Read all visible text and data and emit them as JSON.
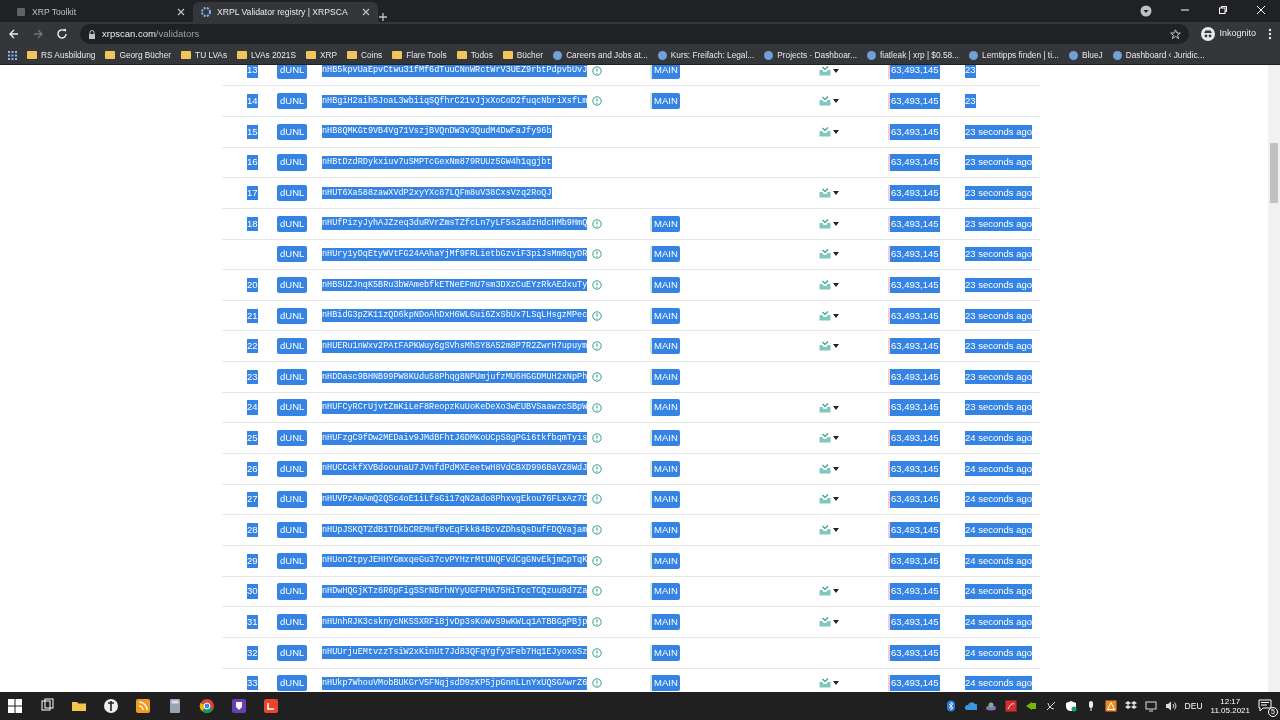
{
  "browser": {
    "tabs": [
      {
        "title": "XRP Toolkit",
        "selected": false
      },
      {
        "title": "XRPL Validator registry | XRPSCA",
        "selected": true
      }
    ],
    "url_host": "xrpscan.com",
    "url_path": "/validators",
    "profile": "Inkognito",
    "bookmarks": [
      {
        "label": "RS Ausbildung",
        "kind": "folder"
      },
      {
        "label": "Georg Bücher",
        "kind": "folder"
      },
      {
        "label": "TU LVAs",
        "kind": "folder"
      },
      {
        "label": "LVAs 2021S",
        "kind": "folder"
      },
      {
        "label": "XRP",
        "kind": "folder"
      },
      {
        "label": "Coins",
        "kind": "folder"
      },
      {
        "label": "Flare Tools",
        "kind": "folder"
      },
      {
        "label": "Todos",
        "kind": "folder"
      },
      {
        "label": "Bücher",
        "kind": "folder"
      },
      {
        "label": "Careers and Jobs at...",
        "kind": "site"
      },
      {
        "label": "Kurs: Freifach: Legal...",
        "kind": "site"
      },
      {
        "label": "Projects · Dashboar...",
        "kind": "site"
      },
      {
        "label": "fiatleak | xrp | $0.58...",
        "kind": "site"
      },
      {
        "label": "Lerntipps finden | ti...",
        "kind": "site"
      },
      {
        "label": "BlueJ",
        "kind": "site"
      },
      {
        "label": "Dashboard ‹ Juridic...",
        "kind": "site"
      }
    ]
  },
  "text_selected": true,
  "validators": [
    {
      "number": "13",
      "unl": "dUNL",
      "key": "nHB5kpvUaEpvCtwu31fMf6dTuuCNnWRctWrV3UEZ9rbtPdpvbUvJ",
      "network": "MAIN",
      "domain_icon": true,
      "ledger": "63,493,145",
      "last_seen": "23"
    },
    {
      "number": "14",
      "unl": "dUNL",
      "key": "nHBgiH2aih5JoaL3wbiiqSQfhrC21vJjxXoCoD2fuqcNbriXsfLm",
      "network": "MAIN",
      "domain_icon": true,
      "ledger": "63,493,145",
      "last_seen": "23"
    },
    {
      "number": "15",
      "unl": "dUNL",
      "key": "nHB8QMKGt9VB4Vg71VszjBVQnDW3v3QudM4DwFaJfy96b",
      "domain_icon": true,
      "ledger": "63,493,145",
      "last_seen": "23 seconds ago"
    },
    {
      "number": "16",
      "unl": "dUNL",
      "key": "nHBtDzdRDykxiuv7uSMPTcGexNm879RUUz5GW4h1qgjbt",
      "domain_icon": false,
      "ledger": "63,493,145",
      "last_seen": "23 seconds ago"
    },
    {
      "number": "17",
      "unl": "dUNL",
      "key": "nHUT6Xa588zawXVdP2xyYXc87LQFm8uV38CxsVzq2RoQJ",
      "domain_icon": true,
      "ledger": "63,493,145",
      "last_seen": "23 seconds ago"
    },
    {
      "number": "18",
      "unl": "dUNL",
      "key": "nHUfPizyJyhAJZzeq3duRVrZmsTZfcLn7yLF5s2adzHdcHMb9HmQ",
      "network": "MAIN",
      "domain_icon": true,
      "ledger": "63,493,145",
      "last_seen": "23 seconds ago"
    },
    {
      "unl": "dUNL",
      "key": "nHUry1yDqEtyWVtFG24AAhaYjMf9FRLietbGzviF3piJsMm9qyDR",
      "network": "MAIN",
      "domain_icon": true,
      "ledger": "63,493,145",
      "last_seen": "23 seconds ago"
    },
    {
      "number": "20",
      "unl": "dUNL",
      "key": "nHBSUZJnqK5BRu3bWAmebfkETNeEFmU7sm3DXzCuEYzRkAEdxuTy",
      "network": "MAIN",
      "domain_icon": true,
      "ledger": "63,493,145",
      "last_seen": "23 seconds ago"
    },
    {
      "number": "21",
      "unl": "dUNL",
      "key": "nHBidG3pZK11zQD6kpNDoAhDxH6WLGui6ZxSbUx7LSqLHsgzMPec",
      "network": "MAIN",
      "domain_icon": true,
      "ledger": "63,493,145",
      "last_seen": "23 seconds ago"
    },
    {
      "number": "22",
      "unl": "dUNL",
      "key": "nHUERu1nWxv2PAtFAPKWuy6gSVhsMhSY8A52m8P7R2ZwrH7upuym",
      "network": "MAIN",
      "domain_icon": true,
      "ledger": "63,493,145",
      "last_seen": "23 seconds ago"
    },
    {
      "number": "23",
      "unl": "dUNL",
      "key": "nHDDasc9BHNB99PW8KUdu58Phqg8NPUmjufzMU6HGGDMUH2xNpPh",
      "network": "MAIN",
      "domain_icon": false,
      "ledger": "63,493,145",
      "last_seen": "23 seconds ago"
    },
    {
      "number": "24",
      "unl": "dUNL",
      "key": "nHUFCyRCrUjvtZmKiLeF8ReopzKuUoKeDeXo3wEUBVSaawzcSBpW",
      "network": "MAIN",
      "domain_icon": true,
      "ledger": "63,493,145",
      "last_seen": "23 seconds ago"
    },
    {
      "number": "25",
      "unl": "dUNL",
      "key": "nHUFzgC9fDw2MEDaiv9JMdBFhtJ6DMKoUCpS8gPGi6tkfbqmTyis",
      "network": "MAIN",
      "domain_icon": true,
      "ledger": "63,493,145",
      "last_seen": "24 seconds ago"
    },
    {
      "number": "26",
      "unl": "dUNL",
      "key": "nHUCCckfXVBdoounaU7JVnfdPdMXEeetwH8VdCBXD996BaVZ8WdJ",
      "network": "MAIN",
      "domain_icon": true,
      "ledger": "63,493,145",
      "last_seen": "24 seconds ago"
    },
    {
      "number": "27",
      "unl": "dUNL",
      "key": "nHUVPzAmAmQ2QSc4oE1iLfsGi17qN2ado8PhxvgEkou76FLxAz7C",
      "network": "MAIN",
      "domain_icon": true,
      "ledger": "63,493,145",
      "last_seen": "24 seconds ago"
    },
    {
      "number": "28",
      "unl": "dUNL",
      "key": "nHUpJSKQTZdB1TDkbCREMuf8vEqFkk84BcvZDhsQsDufFDQVajam",
      "network": "MAIN",
      "domain_icon": true,
      "ledger": "63,493,145",
      "last_seen": "24 seconds ago"
    },
    {
      "number": "29",
      "unl": "dUNL",
      "key": "nHUon2tpyJEHHYGmxqeGu37cvPYHzrMtUNQFVdCgGNvEkjmCpTqK",
      "network": "MAIN",
      "domain_icon": false,
      "ledger": "63,493,145",
      "last_seen": "24 seconds ago"
    },
    {
      "number": "30",
      "unl": "dUNL",
      "key": "nHDwHQGjKTz6R6pFigSSrNBrhNYyUGFPHA75HiTccTCQzuu9d7Za",
      "network": "MAIN",
      "domain_icon": true,
      "ledger": "63,493,145",
      "last_seen": "24 seconds ago"
    },
    {
      "number": "31",
      "unl": "dUNL",
      "key": "nHUnhRJK3csknycNK5SXRFi8jvDp3sKoWvS9wKWLq1ATBBGgPBjp",
      "network": "MAIN",
      "domain_icon": true,
      "ledger": "63,493,145",
      "last_seen": "24 seconds ago"
    },
    {
      "number": "32",
      "unl": "dUNL",
      "key": "nHUUrjuEMtvzzTsiW2xKinUt7Jd83QFqYgfy3Feb7Hq1EJyoxoSz",
      "network": "MAIN",
      "domain_icon": false,
      "ledger": "63,493,145",
      "last_seen": "24 seconds ago"
    },
    {
      "number": "33",
      "unl": "dUNL",
      "key": "nHUkp7WhouVMobBUKGrV5FNqjsdD9zKP5jpGnnLLnYxUQSGAwrZ6",
      "network": "MAIN",
      "domain_icon": true,
      "ledger": "63,493,145",
      "last_seen": "24 seconds ago"
    }
  ],
  "taskbar": {
    "language": "DEU",
    "time": "12:17",
    "date": "11.05.2021",
    "notifications": "5"
  }
}
